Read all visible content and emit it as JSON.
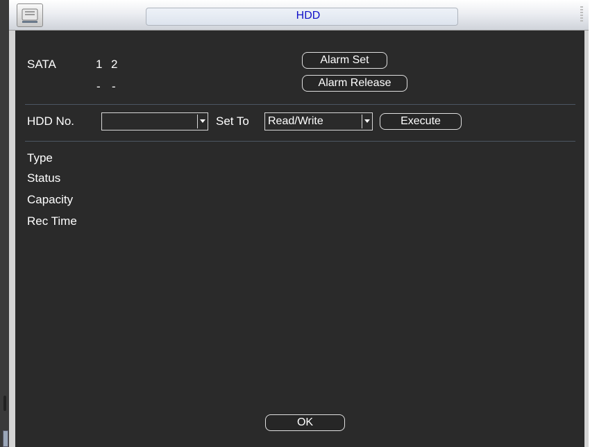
{
  "window": {
    "title": "HDD"
  },
  "sata": {
    "label": "SATA",
    "ports": [
      "1",
      "2"
    ],
    "states": [
      "-",
      "-"
    ]
  },
  "alarm": {
    "set_label": "Alarm Set",
    "release_label": "Alarm Release"
  },
  "controls": {
    "hdd_no_label": "HDD No.",
    "hdd_no_value": "",
    "set_to_label": "Set To",
    "set_to_value": "Read/Write",
    "execute_label": "Execute"
  },
  "info": {
    "type_label": "Type",
    "status_label": "Status",
    "capacity_label": "Capacity",
    "rec_time_label": "Rec Time"
  },
  "footer": {
    "ok_label": "OK"
  },
  "colors": {
    "panel_bg": "#2a2a2a",
    "title_text": "#1010c8",
    "text": "#ffffff"
  },
  "icons": {
    "title_icon": "hdd-icon",
    "dropdown_icon": "chevron-down-icon"
  }
}
